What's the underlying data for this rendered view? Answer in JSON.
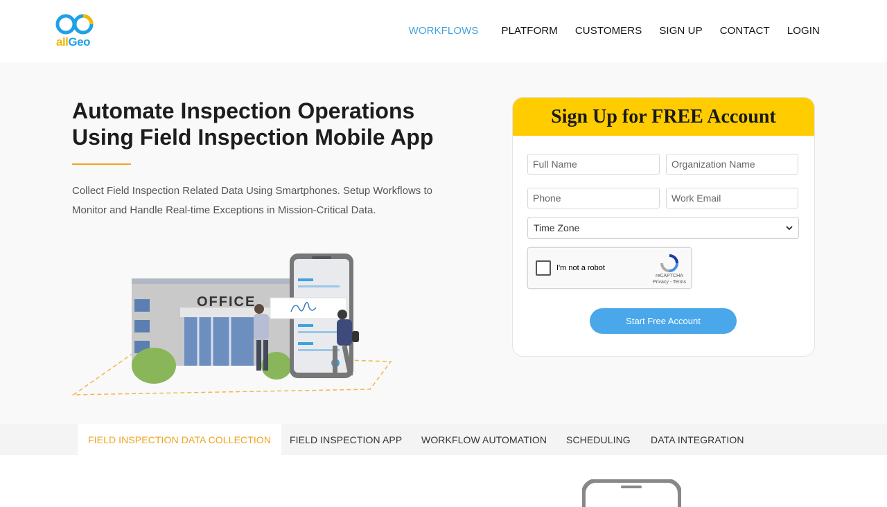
{
  "header": {
    "logo": {
      "all": "all",
      "geo": "Geo"
    },
    "nav": [
      {
        "label": "WORKFLOWS",
        "active": true
      },
      {
        "label": "PLATFORM",
        "active": false
      },
      {
        "label": "CUSTOMERS",
        "active": false
      },
      {
        "label": "SIGN UP",
        "active": false
      },
      {
        "label": "CONTACT",
        "active": false
      },
      {
        "label": "LOGIN",
        "active": false
      }
    ]
  },
  "hero": {
    "title": "Automate Inspection Operations Using Field Inspection Mobile App",
    "description": "Collect Field Inspection Related Data Using Smartphones. Setup Workflows to Monitor and Handle Real-time Exceptions in Mission-Critical Data.",
    "illustration": {
      "sign_text": "OFFICE",
      "icon": "office-inspection-illustration"
    }
  },
  "signup_form": {
    "title": "Sign Up for FREE Account",
    "full_name_placeholder": "Full Name",
    "organization_placeholder": "Organization Name",
    "phone_placeholder": "Phone",
    "email_placeholder": "Work Email",
    "timezone_selected": "Time Zone",
    "captcha": {
      "label": "I'm not a robot",
      "brand": "reCAPTCHA",
      "links": "Privacy - Terms"
    },
    "submit_label": "Start Free Account"
  },
  "tabs": [
    {
      "label": "FIELD INSPECTION DATA COLLECTION",
      "active": true
    },
    {
      "label": "FIELD INSPECTION APP",
      "active": false
    },
    {
      "label": "WORKFLOW AUTOMATION",
      "active": false
    },
    {
      "label": "SCHEDULING",
      "active": false
    },
    {
      "label": "DATA INTEGRATION",
      "active": false
    }
  ],
  "colors": {
    "accent_blue": "#3fa2de",
    "accent_orange": "#f0a31e",
    "form_header": "#ffcc00",
    "button": "#4aa8ea"
  }
}
